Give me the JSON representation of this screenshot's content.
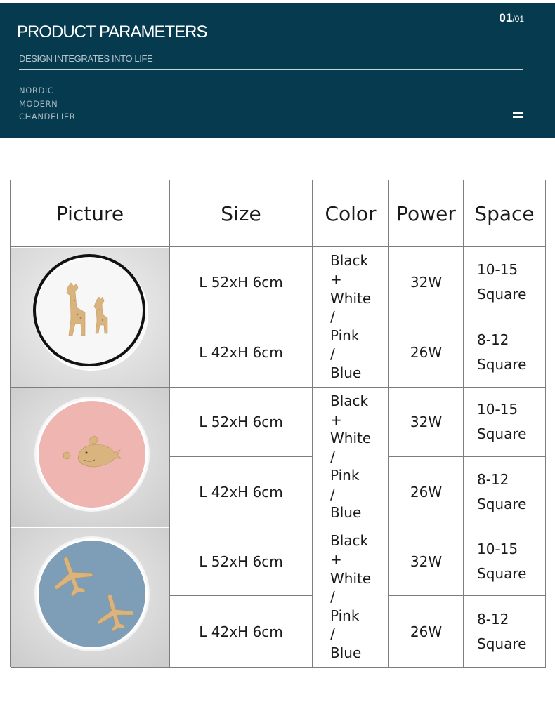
{
  "header": {
    "title": "PRODUCT PARAMETERS",
    "subtitle": "DESIGN INTEGRATES INTO LIFE",
    "tags": [
      "NORDIC",
      "MODERN",
      "CHANDELIER"
    ],
    "page_current": "01",
    "page_total": "/01",
    "menu_icon": "hamburger-menu-icon"
  },
  "table": {
    "columns": [
      "Picture",
      "Size",
      "Color",
      "Power",
      "Space"
    ],
    "products": [
      {
        "image": "giraffe-lamp",
        "color": "Black\n+\nWhite\n/\nPink\n/\nBlue",
        "variants": [
          {
            "size": "L 52xH 6cm",
            "power": "32W",
            "space": "10-15\nSquare"
          },
          {
            "size": "L 42xH 6cm",
            "power": "26W",
            "space": "8-12\nSquare"
          }
        ]
      },
      {
        "image": "whale-lamp",
        "color": "Black\n+\nWhite\n/\nPink\n/\nBlue",
        "variants": [
          {
            "size": "L 52xH 6cm",
            "power": "32W",
            "space": "10-15\nSquare"
          },
          {
            "size": "L 42xH 6cm",
            "power": "26W",
            "space": "8-12\nSquare"
          }
        ]
      },
      {
        "image": "airplane-lamp",
        "color": "Black\n+\nWhite\n/\nPink\n/\nBlue",
        "variants": [
          {
            "size": "L 52xH 6cm",
            "power": "32W",
            "space": "10-15\nSquare"
          },
          {
            "size": "L 42xH 6cm",
            "power": "26W",
            "space": "8-12\nSquare"
          }
        ]
      }
    ]
  },
  "colors": {
    "banner": "#063a4e",
    "border": "#7d7d7d",
    "wood": "#d9b47e",
    "pink_lamp": "#efb5b0",
    "blue_lamp": "#7e9db7"
  }
}
